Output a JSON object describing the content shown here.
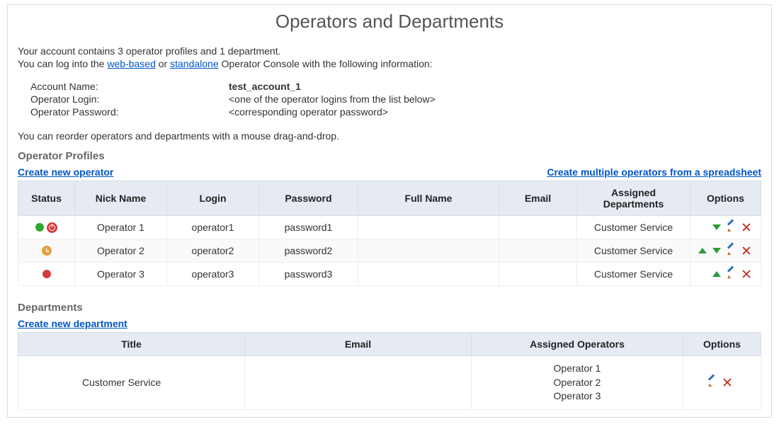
{
  "title": "Operators and Departments",
  "intro": {
    "line1_a": "Your account contains 3 operator profiles and 1 department.",
    "line2_a": "You can log into the ",
    "link_web": "web-based",
    "line2_or": " or ",
    "link_standalone": "standalone",
    "line2_b": " Operator Console with the following information:"
  },
  "account_info": {
    "rows": [
      {
        "label": "Account Name:",
        "value": "test_account_1",
        "bold": true
      },
      {
        "label": "Operator Login:",
        "value": "<one of the operator logins from the list below>",
        "bold": false
      },
      {
        "label": "Operator Password:",
        "value": "<corresponding operator password>",
        "bold": false
      }
    ]
  },
  "reorder_note": "You can reorder operators and departments with a mouse drag-and-drop.",
  "operators": {
    "heading": "Operator Profiles",
    "create_link": "Create new operator",
    "bulk_link": "Create multiple operators from a spreadsheet",
    "columns": [
      "Status",
      "Nick Name",
      "Login",
      "Password",
      "Full Name",
      "Email",
      "Assigned Departments",
      "Options"
    ],
    "rows": [
      {
        "status": "online",
        "nick": "Operator 1",
        "login": "operator1",
        "password": "password1",
        "full": "",
        "email": "",
        "dept": "Customer Service",
        "opts": [
          "down",
          "edit",
          "delete"
        ]
      },
      {
        "status": "away",
        "nick": "Operator 2",
        "login": "operator2",
        "password": "password2",
        "full": "",
        "email": "",
        "dept": "Customer Service",
        "opts": [
          "up",
          "down",
          "edit",
          "delete"
        ]
      },
      {
        "status": "offline",
        "nick": "Operator 3",
        "login": "operator3",
        "password": "password3",
        "full": "",
        "email": "",
        "dept": "Customer Service",
        "opts": [
          "up",
          "edit",
          "delete"
        ]
      }
    ]
  },
  "departments": {
    "heading": "Departments",
    "create_link": "Create new department",
    "columns": [
      "Title",
      "Email",
      "Assigned Operators",
      "Options"
    ],
    "rows": [
      {
        "title": "Customer Service",
        "email": "",
        "assigned": [
          "Operator 1",
          "Operator 2",
          "Operator 3"
        ],
        "opts": [
          "edit",
          "delete"
        ]
      }
    ]
  }
}
